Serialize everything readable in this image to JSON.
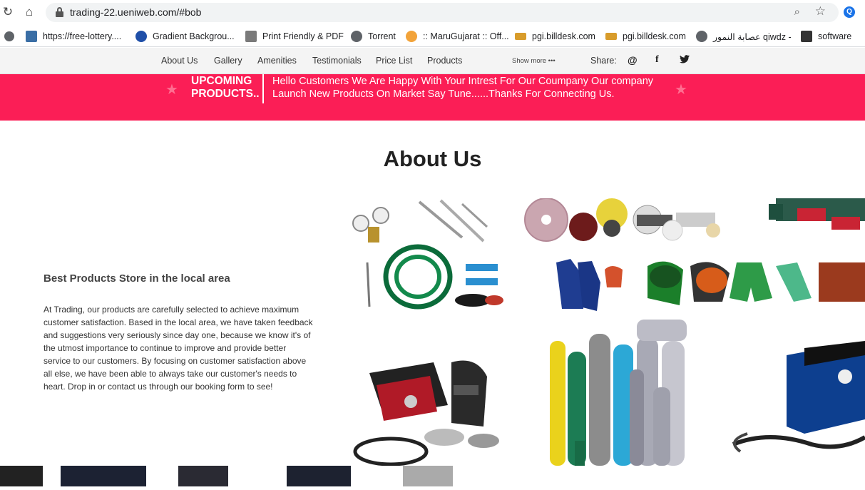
{
  "browser": {
    "url": "trading-22.ueniweb.com/#bob",
    "profile_initial": "Q"
  },
  "bookmarks": [
    {
      "label": "https://free-lottery...."
    },
    {
      "label": "Gradient Backgrou..."
    },
    {
      "label": "Print Friendly & PDF"
    },
    {
      "label": "Torrent"
    },
    {
      "label": ":: MaruGujarat :: Off..."
    },
    {
      "label": "pgi.billdesk.com"
    },
    {
      "label": "pgi.billdesk.com"
    },
    {
      "label": "عصابة النمور qiwdz -"
    },
    {
      "label": "software"
    }
  ],
  "nav": {
    "items": [
      "About Us",
      "Gallery",
      "Amenities",
      "Testimonials",
      "Price List",
      "Products"
    ],
    "show_more": "Show more •••",
    "share_label": "Share:"
  },
  "banner": {
    "title": "UPCOMING PRODUCTS..",
    "message": "Hello Customers We Are Happy With Your Intrest For Our Coumpany Our company Launch New Products On Market Say Tune......Thanks For Connecting Us."
  },
  "about": {
    "title": "About Us",
    "subheading": "Best Products Store in the local area",
    "body": "At Trading, our products are carefully selected to achieve maximum customer satisfaction. Based in the local area, we have taken feedback and suggestions very seriously since day one, because we know it's of the utmost importance to continue to improve and provide better service to our customers. By focusing on customer satisfaction above all else, we have been able to always take our customer's needs to heart. Drop in or contact us through our booking form to see!"
  },
  "colors": {
    "banner": "#fb1e56",
    "nav_bg": "#f4f4f4"
  }
}
